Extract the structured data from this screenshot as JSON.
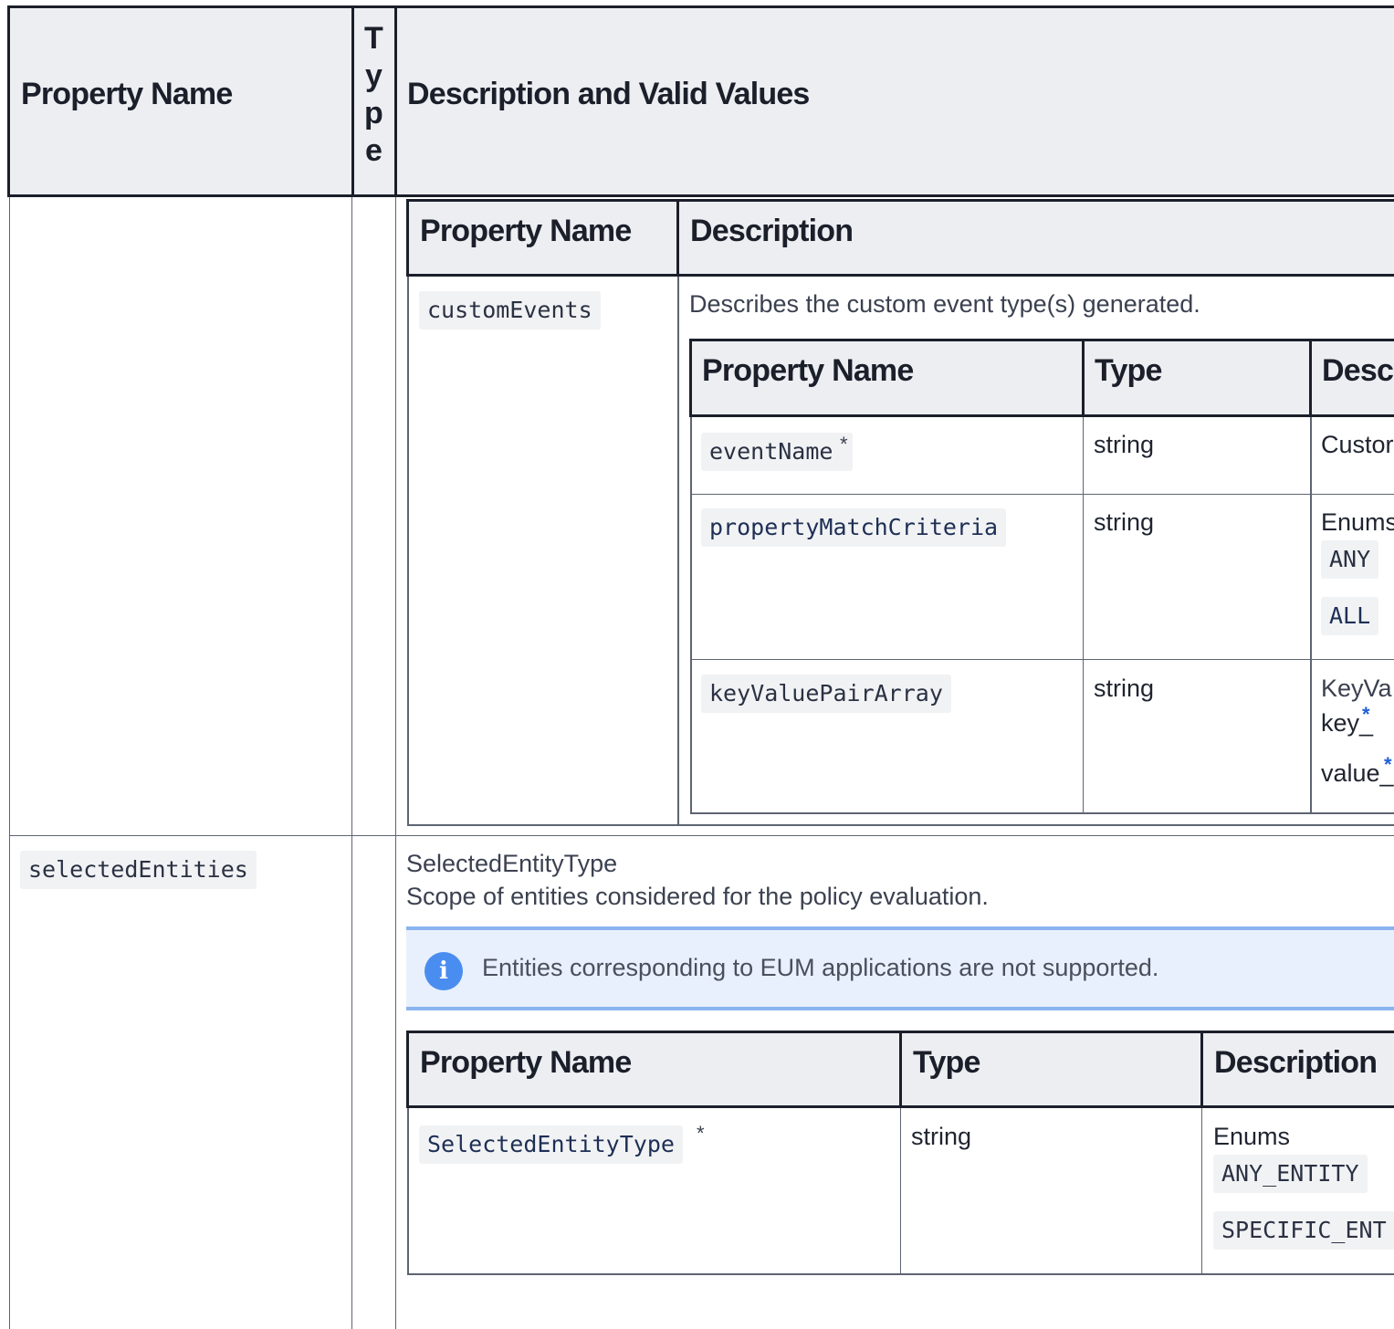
{
  "outer_table": {
    "headers": {
      "property_name": "Property Name",
      "type": "Type",
      "description": "Description and Valid Values"
    }
  },
  "nested_table_1": {
    "headers": {
      "property_name": "Property Name",
      "description": "Description"
    },
    "row": {
      "name": "customEvents",
      "description": "Describes the custom event type(s) generated."
    }
  },
  "nested_table_2": {
    "headers": {
      "property_name": "Property Name",
      "type": "Type",
      "description": "Desc"
    },
    "rows": [
      {
        "name": "eventName",
        "required_mark": "*",
        "type": "string",
        "description": "Custor"
      },
      {
        "name": "propertyMatchCriteria",
        "type": "string",
        "description": "Enums",
        "enums": [
          "ANY",
          "ALL"
        ]
      },
      {
        "name": "keyValuePairArray",
        "type": "string",
        "description": "KeyVa",
        "key_label": "key_",
        "value_label": "value_",
        "required_mark": "*"
      }
    ]
  },
  "row_selected_entities": {
    "name": "selectedEntities",
    "type_title": "SelectedEntityType",
    "scope_text": "Scope of entities considered for the policy evaluation.",
    "info_note": "Entities corresponding to EUM applications are not supported.",
    "info_icon": "info-icon"
  },
  "nested_table_3": {
    "headers": {
      "property_name": "Property Name",
      "type": "Type",
      "description": "Description"
    },
    "row": {
      "name": "SelectedEntityType",
      "required_mark": "*",
      "type": "string",
      "description": "Enums",
      "enums": [
        "ANY_ENTITY",
        "SPECIFIC_ENT"
      ]
    }
  },
  "colors": {
    "header_bg": "#eceef2",
    "info_bg": "#e8f0fd",
    "info_border": "#8ab4f0",
    "info_icon": "#4a8df0",
    "link_star": "#1f5fd6"
  }
}
